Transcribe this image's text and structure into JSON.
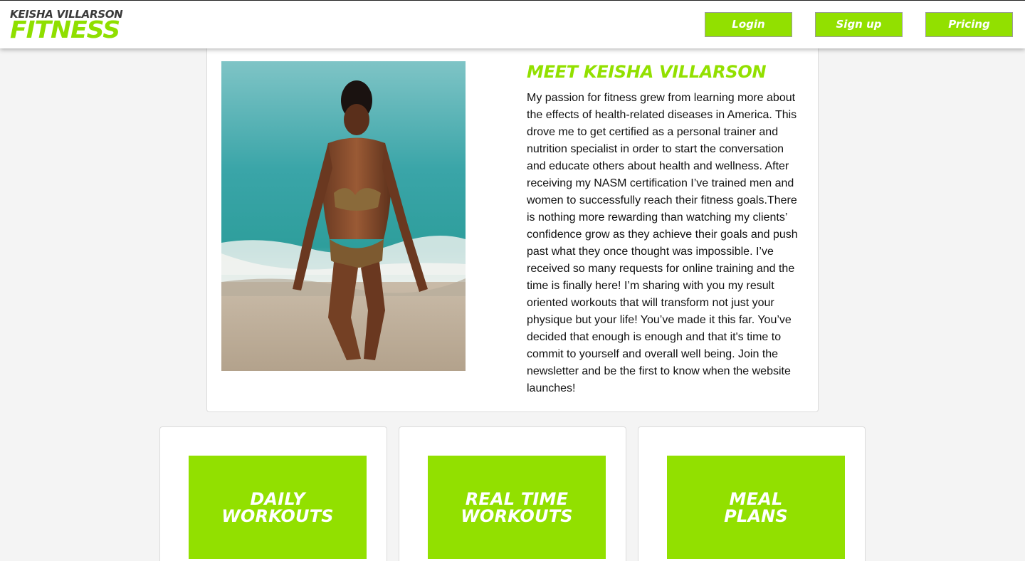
{
  "header": {
    "logo_top": "KEISHA VILLARSON",
    "logo_bottom": "FITNESS",
    "nav": {
      "login": "Login",
      "signup": "Sign up",
      "pricing": "Pricing"
    }
  },
  "about": {
    "title": "MEET KEISHA VILLARSON",
    "body": "My passion for fitness grew from learning more about the effects of health-related diseases in America. This drove me to get certified as a personal trainer and nutrition specialist in order to start the conversation and educate others about health and wellness. After receiving my NASM certification I’ve trained men and women to successfully reach their fitness goals.There is nothing more rewarding than watching my clients’ confidence grow as they achieve their goals and push past what they once thought was impossible. I’ve received so many requests for online training and the time is finally here! I’m sharing with you my result oriented workouts that will transform not just your physique but your life! You’ve made it this far. You’ve decided that enough is enough and that it's time to commit to yourself and overall well being. Join the newsletter and be the first to know when the website launches!"
  },
  "features": [
    {
      "label": "DAILY\nWORKOUTS"
    },
    {
      "label": "REAL TIME\nWORKOUTS"
    },
    {
      "label": "MEAL\nPLANS"
    }
  ],
  "colors": {
    "accent": "#92e000",
    "background": "#f4f4f4",
    "card": "#ffffff",
    "logo_dark": "#3a3a3a"
  }
}
